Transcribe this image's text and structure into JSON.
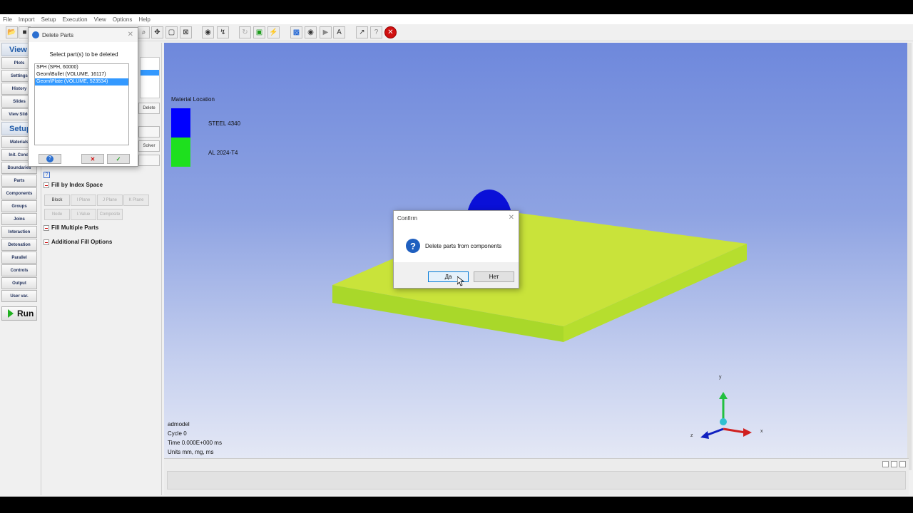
{
  "menu": [
    "File",
    "Import",
    "Setup",
    "Execution",
    "View",
    "Options",
    "Help"
  ],
  "sidebar": {
    "view_header": "View",
    "view_items": [
      "Plots",
      "Settings",
      "History",
      "Slides",
      "View Slide"
    ],
    "setup_header": "Setup",
    "setup_items": [
      "Materials",
      "Init. Cond.",
      "Boundaries",
      "Parts",
      "Components",
      "Groups",
      "Joins",
      "Interaction",
      "Detonation",
      "Parallel",
      "Controls",
      "Output",
      "User var."
    ],
    "run_label": "Run"
  },
  "panel": {
    "delete_label": "Delete",
    "solver_label": "Solver",
    "help_mark": "?",
    "fill_index_title": "Fill by Index Space",
    "fill_index_buttons": [
      "Block",
      "I Plane",
      "J Plane",
      "K Plane",
      "Node",
      "I-Value",
      "Composite"
    ],
    "fill_multiple_title": "Fill Multiple Parts",
    "additional_title": "Additional Fill Options"
  },
  "viewport": {
    "legend_title": "Material Location",
    "legend": [
      {
        "label": "STEEL 4340",
        "color": "#0000ff"
      },
      {
        "label": "AL 2024-T4",
        "color": "#1ee01e"
      }
    ],
    "info": [
      "admodel",
      "Cycle 0",
      "Time 0.000E+000 ms",
      "Units mm, mg, ms"
    ],
    "axes": {
      "x": "x",
      "y": "y",
      "z": "z"
    }
  },
  "delete_parts_dialog": {
    "title": "Delete Parts",
    "prompt": "Select part(s) to be deleted",
    "items": [
      "SPH (SPH, 60000)",
      "Geom\\Bullet (VOLUME, 16117)",
      "Geom\\Plate (VOLUME, 523534)"
    ],
    "selected_index": 2
  },
  "confirm_dialog": {
    "title": "Confirm",
    "message": "Delete parts from components",
    "yes_label": "Да",
    "no_label": "Нет"
  }
}
